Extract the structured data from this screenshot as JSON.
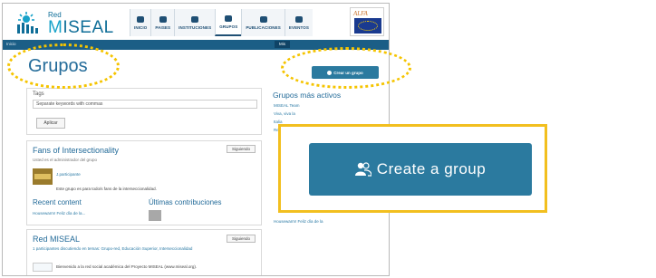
{
  "header": {
    "logo_small": "Red",
    "logo_main_a": "M",
    "logo_main_b": "ISEAL",
    "eu_text": "ALFA"
  },
  "nav": [
    {
      "label": "INICIO",
      "active": false
    },
    {
      "label": "PAISES",
      "active": false
    },
    {
      "label": "INSTITUCIONES",
      "active": false
    },
    {
      "label": "GRUPOS",
      "active": true
    },
    {
      "label": "PUBLICACIONES",
      "active": false
    },
    {
      "label": "EVENTOS",
      "active": false
    }
  ],
  "subbar": {
    "crumbs": "Inicio",
    "mine": "Mis"
  },
  "page": {
    "title": "Grupos",
    "create_small": "Crear un grupo"
  },
  "filter": {
    "label": "Tags",
    "placeholder": "Separate keywords with commas",
    "apply": "Aplicar"
  },
  "groups": [
    {
      "title": "Fans of Intersectionality",
      "subtitle": "Usted es el administrador del grupo",
      "follow": "Siguiendo",
      "author": "J.participante",
      "description": "Este grupo es para todo/s fans de la interseccionalidad.",
      "recent_label": "Recent content",
      "recent_item": "Housewarm! Feliz día de la...",
      "contrib_label": "Últimas contribuciones"
    },
    {
      "title": "Red MISEAL",
      "subtitle": "1 participantes discutiendo en temas: Grupo-red, Educación Superior, Interseccionalidad",
      "follow": "Siguiendo",
      "description": "Bienvenido a la red social académica del Proyecto MISEAL (www.miseal.org)."
    }
  ],
  "sidebar": {
    "title": "Grupos más activos",
    "items": [
      "MISEAL Team",
      "Viva, viva la",
      "Italia",
      "Red"
    ],
    "footer_item": "Housewarm! Feliz día de la"
  },
  "callout": {
    "label": "Create a group"
  },
  "colors": {
    "brand": "#236b99",
    "button": "#2b7a9f",
    "highlight": "#f2bf1f"
  }
}
